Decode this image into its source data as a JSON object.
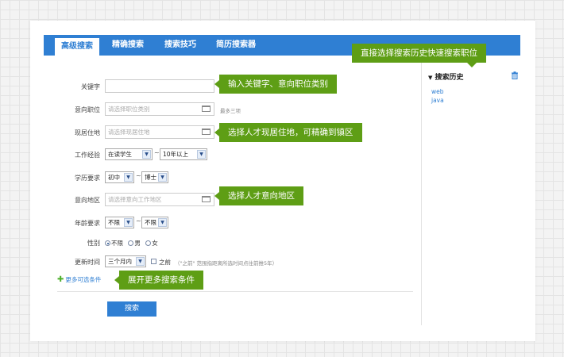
{
  "tabs": [
    {
      "label": "高级搜索",
      "active": true
    },
    {
      "label": "精确搜索",
      "active": false
    },
    {
      "label": "搜索技巧",
      "active": false
    },
    {
      "label": "简历搜索器",
      "active": false
    }
  ],
  "form": {
    "keyword": {
      "label": "关键字",
      "value": ""
    },
    "job_category": {
      "label": "意向职位",
      "placeholder": "请选择职位类别",
      "hint": "最多三项"
    },
    "residence": {
      "label": "现居住地",
      "placeholder": "请选择现居住地"
    },
    "experience": {
      "label": "工作经验",
      "from": "在读学生",
      "to": "10年以上",
      "separator": "~"
    },
    "education": {
      "label": "学历要求",
      "from": "初中",
      "to": "博士",
      "separator": "~"
    },
    "intended_area": {
      "label": "意向地区",
      "placeholder": "请选择意向工作地区"
    },
    "age": {
      "label": "年龄要求",
      "from": "不限",
      "to": "不限",
      "separator": "~"
    },
    "gender": {
      "label": "性别",
      "options": [
        "不限",
        "男",
        "女"
      ],
      "selected": "不限"
    },
    "update_time": {
      "label": "更新时间",
      "value": "三个月内",
      "before_label": "之前",
      "before_checked": false,
      "note": "（\"之前\" 范围指距离所选时间点往前推5年）"
    }
  },
  "more_options": {
    "label": "更多可选条件"
  },
  "search_button": {
    "label": "搜索"
  },
  "history": {
    "title": "搜索历史",
    "items": [
      "web",
      "java"
    ]
  },
  "callouts": {
    "history": "直接选择搜索历史快速搜索职位",
    "keyword": "输入关键字、意向职位类别",
    "residence": "选择人才现居住地，可精确到镇区",
    "area": "选择人才意向地区",
    "more": "展开更多搜索条件"
  },
  "colors": {
    "tab_blue": "#2f7fd3",
    "callout_green": "#5e9e15",
    "link_blue": "#2f7fd3"
  }
}
